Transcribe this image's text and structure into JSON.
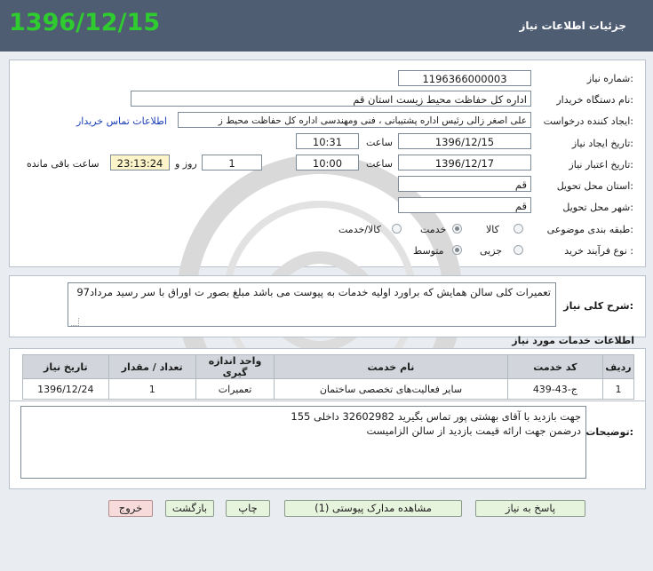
{
  "header": {
    "title": "جزئیات اطلاعات نیاز",
    "date_stamp": "1396/12/15"
  },
  "form": {
    "need_number_label": "شماره نیاز:",
    "need_number": "1196366000003",
    "buyer_org_label": "نام دستگاه خریدار:",
    "buyer_org": "اداره کل حفاظت محیط زیست استان قم",
    "requester_label": "ایجاد کننده درخواست:",
    "requester": "علی اصغر زالی رئیس اداره پشتیبانی ، فنی ومهندسی اداره کل حفاظت محیط ز",
    "contact_link": "اطلاعات تماس خریدار",
    "announce_date_label": "تاریخ ایجاد نیاز:",
    "announce_date": "1396/12/15",
    "time_label": "ساعت",
    "announce_time": "10:31",
    "validity_date_label": "تاریخ اعتبار نیاز:",
    "validity_date": "1396/12/17",
    "validity_time": "10:00",
    "days_remaining": "1",
    "days_label": "روز و",
    "countdown": "23:13:24",
    "countdown_label": "ساعت باقی مانده",
    "province_label": "استان محل تحویل:",
    "province": "قم",
    "city_label": "شهر محل تحویل:",
    "city": "قم",
    "category_label": "طبقه بندی موضوعی:",
    "category_options": [
      "کالا",
      "خدمت",
      "کالا/خدمت"
    ],
    "category_selected": "خدمت",
    "process_label": "نوع فرآیند خرید :",
    "process_options": [
      "جزیی",
      "متوسط"
    ],
    "process_selected": "متوسط"
  },
  "summary": {
    "label": "شرح کلی نیاز:",
    "text": "تعمیرات کلی سالن همایش  که براورد اولیه خدمات به پیوست می باشد مبلغ بصور ت اوراق با سر رسید مرداد97"
  },
  "services": {
    "section_title": "اطلاعات خدمات مورد نیاز",
    "columns": [
      "ردیف",
      "کد خدمت",
      "نام خدمت",
      "واحد اندازه گیری",
      "تعداد / مقدار",
      "تاریخ نیاز"
    ],
    "rows": [
      [
        "1",
        "ج-43-439",
        "سایر فعالیت‌های تخصصی ساختمان",
        "تعمیرات",
        "1",
        "1396/12/24"
      ]
    ]
  },
  "buyer_notes": {
    "label": "توضیحات خریدار:",
    "line1": "جهت بازدید با آقای بهشتی پور تماس بگیرید 32602982 داخلی 155",
    "line2": "درضمن جهت ارائه قیمت بازدید از سالن  الزامیست"
  },
  "buttons": {
    "reply": "پاسخ به نیاز",
    "attachments": "مشاهده مدارک پیوستی (1)",
    "print": "چاپ",
    "back": "بازگشت",
    "exit": "خروج"
  },
  "colors": {
    "header_bg": "#4f5d73",
    "date_stamp": "#2ecc2e",
    "link": "#1a3fb5",
    "countdown_bg": "#fdf5c9",
    "exit_bg": "#f7dada",
    "button_bg": "#e6f4dd"
  }
}
